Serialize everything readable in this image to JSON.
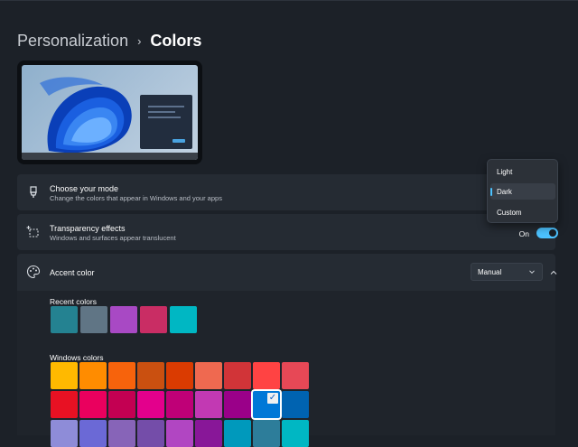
{
  "breadcrumb": {
    "parent": "Personalization",
    "separator": "›",
    "current": "Colors"
  },
  "mode_card": {
    "title": "Choose your mode",
    "subtitle": "Change the colors that appear in Windows and your apps",
    "icon": "brush-icon"
  },
  "mode_popup": {
    "options": [
      {
        "label": "Light",
        "selected": false
      },
      {
        "label": "Dark",
        "selected": true
      },
      {
        "label": "Custom",
        "selected": false
      }
    ]
  },
  "transparency_card": {
    "title": "Transparency effects",
    "subtitle": "Windows and surfaces appear translucent",
    "toggle_label": "On",
    "toggle_on": true,
    "icon": "transparency-icon"
  },
  "accent_card": {
    "title": "Accent color",
    "dropdown_value": "Manual",
    "icon": "palette-icon"
  },
  "recent_colors": {
    "label": "Recent colors",
    "colors": [
      "#248291",
      "#607585",
      "#a849c4",
      "#c92d64",
      "#00b7c3"
    ]
  },
  "windows_colors": {
    "label": "Windows colors",
    "rows": [
      [
        "#ffb900",
        "#ff8c00",
        "#f7630c",
        "#ca5010",
        "#da3b01",
        "#ef6950",
        "#d13438",
        "#ff4343",
        "#e74856"
      ],
      [
        "#e81123",
        "#ea005e",
        "#c30052",
        "#e3008c",
        "#bf0077",
        "#c239b3",
        "#9a0089",
        "#0078d7",
        "#0063b1"
      ],
      [
        "#8e8cd8",
        "#6b69d6",
        "#8764b8",
        "#744da9",
        "#b146c2",
        "#881798",
        "#0099bc",
        "#2d7d9a",
        "#00b7c3"
      ]
    ],
    "selected": "#0078d7"
  },
  "colors": {
    "accent": "#4cc2ff",
    "background": "#1c2128",
    "card": "#252b33"
  }
}
